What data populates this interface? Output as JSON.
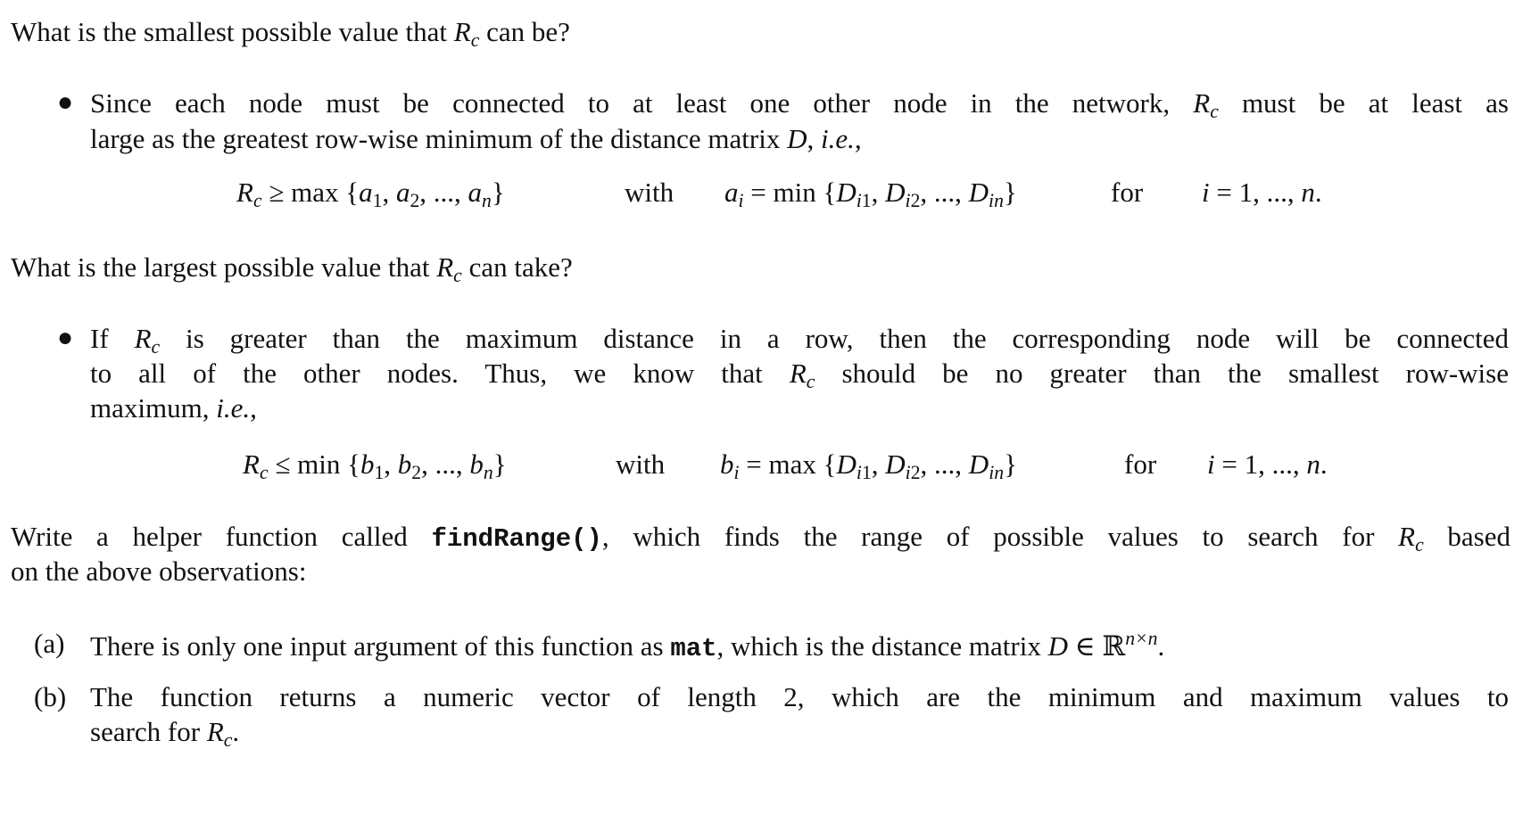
{
  "question1": {
    "before": "What is the smallest possible value that ",
    "sym": "R",
    "sub": "c",
    "after": " can be?"
  },
  "bullet1": {
    "line1_before": "Since each node must be connected to at least one other node in the network, ",
    "line1_after": " must be at least as",
    "line2": "large as the greatest row-wise minimum of the distance matrix ",
    "line2_D": "D",
    "line2_after": ", ",
    "line2_ie": "i.e.,"
  },
  "equation1": {
    "lhs": "≥ max {",
    "lhs_vars": "a₁, a₂, ..., aₙ",
    "lhs_close": "}",
    "with": "with",
    "ai": "a",
    "ai_sub": "i",
    "rhs": " = min {",
    "rhs_vars": "D",
    "rhs_list": "i1, D",
    "rhs_close": "}",
    "for": "for",
    "range": "i = 1, ..., n."
  },
  "question2": {
    "before": "What is the largest possible value that ",
    "after": " can take?"
  },
  "bullet2": {
    "line1_before": "If ",
    "line1_after": " is greater than the maximum distance in a row, then the corresponding node will be connected",
    "line2_before": "to all of the other nodes.  Thus, we know that ",
    "line2_after": " should be no greater than the smallest row-wise",
    "line3": "maximum, ",
    "line3_ie": "i.e.,"
  },
  "equation2": {
    "lhs": "≤ min {",
    "with": "with",
    "bi": "b",
    "rhs": " = max {",
    "for": "for",
    "range": "i = 1, ..., n."
  },
  "task": {
    "line1_before": "Write a helper function called ",
    "func": "findRange()",
    "line1_mid": ", which finds the range of possible values to search for ",
    "line1_after": " based",
    "line2": "on the above observations:"
  },
  "items": [
    {
      "label": "(a)",
      "before": "There is only one input argument of this function as ",
      "code": "mat",
      "after": ", which is the distance matrix ",
      "D": "D",
      "in": " ∈ ℝ",
      "sup": "n×n",
      "end": "."
    },
    {
      "label": "(b)",
      "line1": "The function returns a numeric vector of length 2, which are the minimum and maximum values to",
      "line2_before": "search for ",
      "line2_after": "."
    }
  ]
}
